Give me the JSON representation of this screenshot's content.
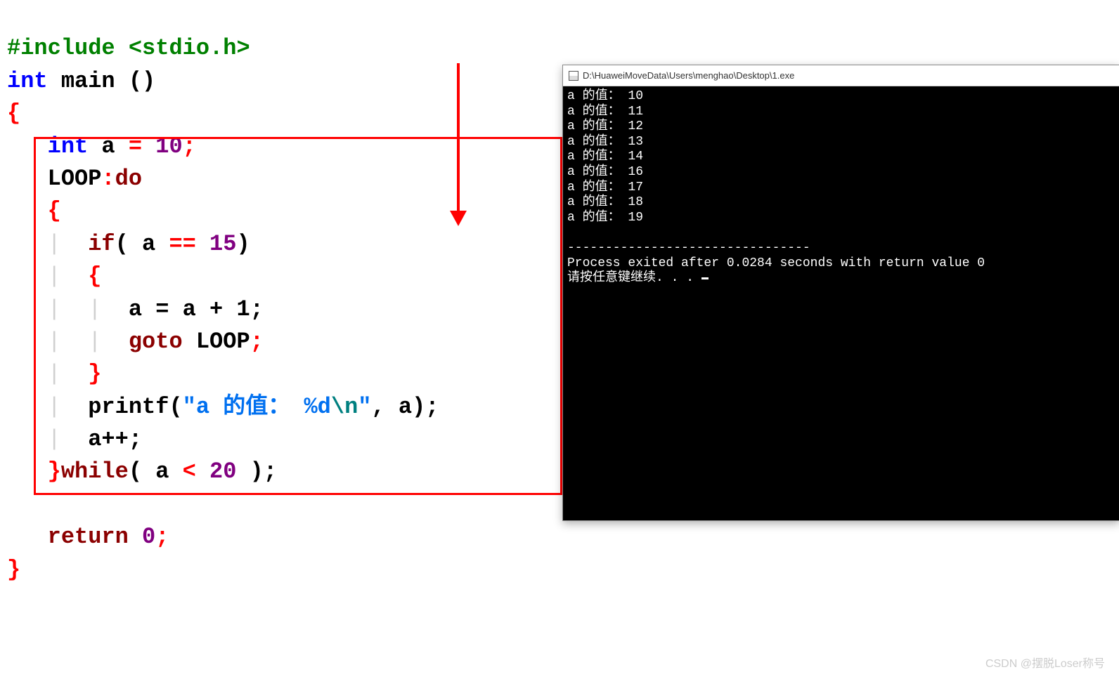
{
  "code": {
    "line1_include": "#include <stdio.h>",
    "kw_int": "int",
    "fn_main": "main",
    "parens": " ()",
    "brace_open": "{",
    "brace_close": "}",
    "kw_int2": "int",
    "var_a": " a ",
    "eq": "= ",
    "num_10": "10",
    "semi": ";",
    "loop_label": "LOOP",
    "colon": ":",
    "kw_do": "do",
    "kw_if": "if",
    "if_open": "( a ",
    "op_eq": "==",
    "num_15": " 15",
    "if_close": ")",
    "assign_a": "a = a + 1;",
    "kw_goto": "goto",
    "goto_target": " LOOP",
    "printf": "printf",
    "str_open": "(",
    "str1": "\"a 的值： %d",
    "str_nl": "\\n",
    "str2": "\"",
    "printf_args": ", a);",
    "incr": "a++;",
    "kw_while": "while",
    "while_open": "( a ",
    "op_lt": "<",
    "num_20": " 20",
    "while_close": " );",
    "kw_return": "return",
    "num_0": " 0"
  },
  "console": {
    "title": "D:\\HuaweiMoveData\\Users\\menghao\\Desktop\\1.exe",
    "output_lines": [
      "a 的值： 10",
      "a 的值： 11",
      "a 的值： 12",
      "a 的值： 13",
      "a 的值： 14",
      "a 的值： 16",
      "a 的值： 17",
      "a 的值： 18",
      "a 的值： 19"
    ],
    "separator": "--------------------------------",
    "exit_msg": "Process exited after 0.0284 seconds with return value 0",
    "prompt": "请按任意键继续. . . "
  },
  "watermark": "CSDN @摆脱Loser称号"
}
